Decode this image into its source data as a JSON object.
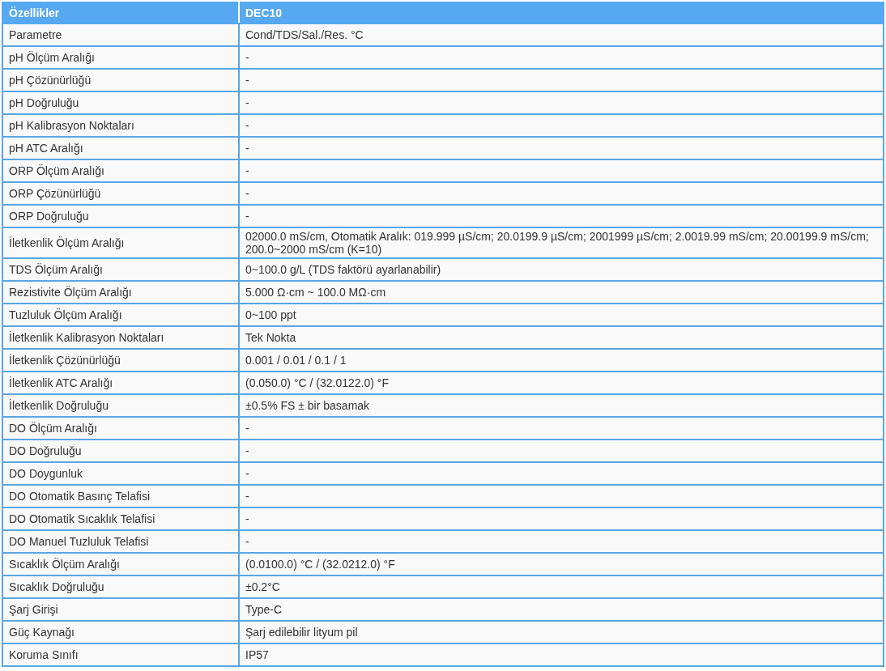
{
  "table": {
    "columns": [
      "Özellikler",
      "DEC10"
    ],
    "rows": [
      [
        "Parametre",
        "Cond/TDS/Sal./Res. °C"
      ],
      [
        "pH Ölçüm Aralığı",
        "-"
      ],
      [
        "pH Çözünürlüğü",
        "-"
      ],
      [
        "pH Doğruluğu",
        "-"
      ],
      [
        "pH Kalibrasyon Noktaları",
        "-"
      ],
      [
        "pH ATC Aralığı",
        "-"
      ],
      [
        "ORP Ölçüm Aralığı",
        "-"
      ],
      [
        "ORP Çözünürlüğü",
        "-"
      ],
      [
        "ORP Doğruluğu",
        "-"
      ],
      [
        "İletkenlik Ölçüm Aralığı",
        "02000.0 mS/cm, Otomatik Aralık: 019.999 µS/cm; 20.0199.9 µS/cm; 2001999 µS/cm; 2.0019.99 mS/cm; 20.00199.9 mS/cm; 200.0~2000 mS/cm (K=10)"
      ],
      [
        "TDS Ölçüm Aralığı",
        "0~100.0 g/L (TDS faktörü ayarlanabilir)"
      ],
      [
        "Rezistivite Ölçüm Aralığı",
        "5.000 Ω·cm ~ 100.0 MΩ·cm"
      ],
      [
        "Tuzluluk Ölçüm Aralığı",
        "0~100 ppt"
      ],
      [
        "İletkenlik Kalibrasyon Noktaları",
        "Tek Nokta"
      ],
      [
        "İletkenlik Çözünürlüğü",
        "0.001 / 0.01 / 0.1 / 1"
      ],
      [
        "İletkenlik ATC Aralığı",
        "(0.050.0) °C / (32.0122.0) °F"
      ],
      [
        "İletkenlik Doğruluğu",
        "±0.5% FS ± bir basamak"
      ],
      [
        "DO Ölçüm Aralığı",
        "-"
      ],
      [
        "DO Doğruluğu",
        "-"
      ],
      [
        "DO Doygunluk",
        "-"
      ],
      [
        "DO Otomatik Basınç Telafisi",
        "-"
      ],
      [
        "DO Otomatik Sıcaklık Telafisi",
        "-"
      ],
      [
        "DO Manuel Tuzluluk Telafisi",
        "-"
      ],
      [
        "Sıcaklık Ölçüm Aralığı",
        "(0.0100.0) °C / (32.0212.0) °F"
      ],
      [
        "Sıcaklık Doğruluğu",
        "±0.2°C"
      ],
      [
        "Şarj Girişi",
        "Type-C"
      ],
      [
        "Güç Kaynağı",
        "Şarj edilebilir lityum pil"
      ],
      [
        "Koruma Sınıfı",
        "IP57"
      ]
    ]
  }
}
